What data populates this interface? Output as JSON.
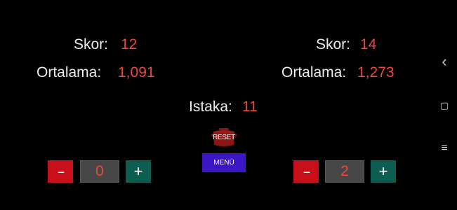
{
  "left": {
    "score_label": "Skor:",
    "score_value": "12",
    "avg_label": "Ortalama:",
    "avg_value": "1,091",
    "minus_label": "--",
    "counter_value": "0",
    "plus_label": "+"
  },
  "right": {
    "score_label": "Skor:",
    "score_value": "14",
    "avg_label": "Ortalama:",
    "avg_value": "1,273",
    "minus_label": "--",
    "counter_value": "2",
    "plus_label": "+"
  },
  "center": {
    "istaka_label": "Istaka:",
    "istaka_value": "11",
    "reset_label": "RESET",
    "menu_label": "MENÜ"
  },
  "nav": {
    "back_icon": "‹",
    "home_icon": "▢",
    "menu_icon": "≡"
  },
  "colors": {
    "background": "#000000",
    "value": "#ea4a3a",
    "minus_button": "#c8101a",
    "plus_button": "#0d5e50",
    "counter_box": "#474747",
    "menu_button": "#3a16c4",
    "reset_button": "#8b1414"
  }
}
